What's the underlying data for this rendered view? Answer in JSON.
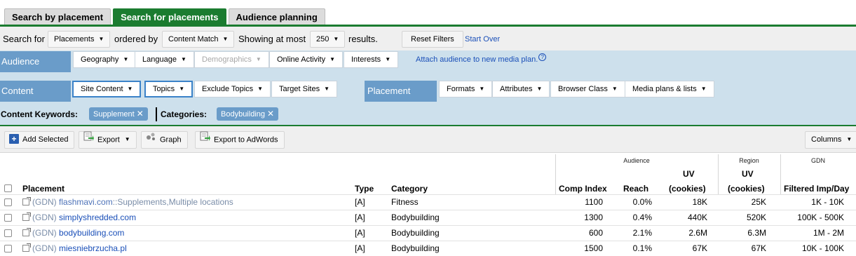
{
  "tabs": [
    "Search by placement",
    "Search for placements",
    "Audience planning"
  ],
  "search_bar": {
    "search_for_label": "Search for",
    "search_for_value": "Placements",
    "ordered_by_label": "ordered by",
    "ordered_by_value": "Content Match",
    "showing_label": "Showing at most",
    "showing_value": "250",
    "results_label": "results.",
    "reset_filters": "Reset Filters",
    "start_over": "Start Over"
  },
  "audience": {
    "label": "Audience",
    "filters": [
      "Geography",
      "Language",
      "Demographics",
      "Online Activity",
      "Interests"
    ],
    "attach_link": "Attach audience to new media plan."
  },
  "content": {
    "label": "Content",
    "filters": [
      "Site Content",
      "Topics",
      "Exclude Topics",
      "Target Sites"
    ]
  },
  "placement": {
    "label": "Placement",
    "filters": [
      "Formats",
      "Attributes",
      "Browser Class",
      "Media plans & lists"
    ]
  },
  "keywords": {
    "content_keywords_label": "Content Keywords:",
    "content_keyword": "Supplement",
    "categories_label": "Categories:",
    "category": "Bodybuilding"
  },
  "toolbar": {
    "add_selected": "Add Selected",
    "export": "Export",
    "graph": "Graph",
    "export_adwords": "Export to AdWords",
    "columns": "Columns"
  },
  "table": {
    "group_headers": {
      "audience": "Audience",
      "region": "Region",
      "gdn": "GDN"
    },
    "columns": {
      "placement": "Placement",
      "type": "Type",
      "category": "Category",
      "comp_index": "Comp Index",
      "reach": "Reach",
      "uv_audience_1": "UV",
      "uv_audience_2": "(cookies)",
      "uv_region_1": "UV",
      "uv_region_2": "(cookies)",
      "filtered": "Filtered Imp/Day"
    },
    "rows": [
      {
        "prefix": "(GDN)",
        "site": "flashmavi.com",
        "suffix": "::Supplements,Multiple locations",
        "type": "[A]",
        "category": "Fitness",
        "comp_index": "1100",
        "reach": "0.0%",
        "uv_audience": "18K",
        "uv_region": "25K",
        "filtered": "1K - 10K"
      },
      {
        "prefix": "(GDN)",
        "site": "simplyshredded.com",
        "suffix": "",
        "type": "[A]",
        "category": "Bodybuilding",
        "comp_index": "1300",
        "reach": "0.4%",
        "uv_audience": "440K",
        "uv_region": "520K",
        "filtered": "100K - 500K"
      },
      {
        "prefix": "(GDN)",
        "site": "bodybuilding.com",
        "suffix": "",
        "type": "[A]",
        "category": "Bodybuilding",
        "comp_index": "600",
        "reach": "2.1%",
        "uv_audience": "2.6M",
        "uv_region": "6.3M",
        "filtered": "1M - 2M"
      },
      {
        "prefix": "(GDN)",
        "site": "miesniebrzucha.pl",
        "suffix": "",
        "type": "[A]",
        "category": "Bodybuilding",
        "comp_index": "1500",
        "reach": "0.1%",
        "uv_audience": "67K",
        "uv_region": "67K",
        "filtered": "10K - 100K"
      }
    ]
  }
}
